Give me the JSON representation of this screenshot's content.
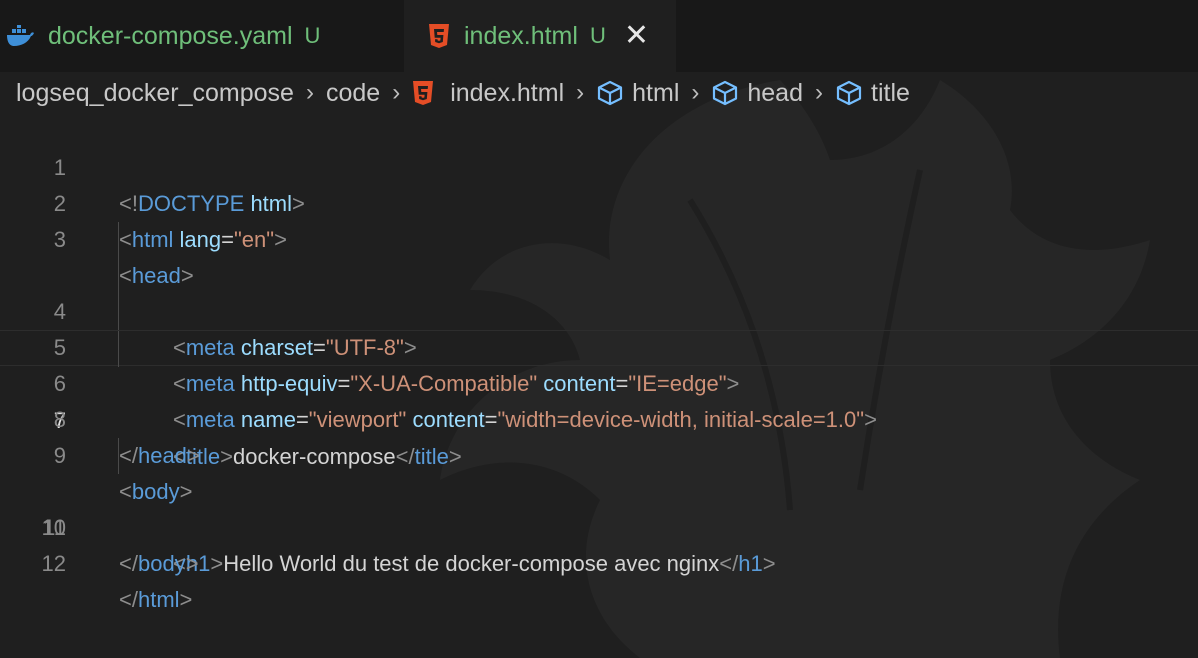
{
  "tabs": [
    {
      "label": "docker-compose.yaml",
      "badge": "U",
      "icon": "docker-whale-icon"
    },
    {
      "label": "index.html",
      "badge": "U",
      "icon": "html5-icon",
      "close": "✕"
    }
  ],
  "breadcrumb": {
    "items": [
      "logseq_docker_compose",
      "code",
      "index.html",
      "html",
      "head",
      "title"
    ],
    "separator": "›"
  },
  "editor": {
    "current_line": 7,
    "line_numbers": [
      "1",
      "2",
      "3",
      "4",
      "5",
      "6",
      "7",
      "8",
      "9",
      "10",
      "11",
      "12"
    ],
    "lines": {
      "l1": {
        "a": "<!",
        "b": "DOCTYPE",
        "c": " html",
        "d": ">"
      },
      "l2": {
        "a": "<",
        "b": "html",
        "c": " lang",
        "d": "=",
        "e": "\"en\"",
        "f": ">"
      },
      "l3": {
        "a": "<",
        "b": "head",
        "c": ">"
      },
      "l4": {
        "a": "<",
        "b": "meta",
        "c": " charset",
        "d": "=",
        "e": "\"UTF-8\"",
        "f": ">"
      },
      "l5": {
        "a": "<",
        "b": "meta",
        "c": " http-equiv",
        "d": "=",
        "e": "\"X-UA-Compatible\"",
        "f": " content",
        "g": "=",
        "h": "\"IE=edge\"",
        "i": ">"
      },
      "l6": {
        "a": "<",
        "b": "meta",
        "c": " name",
        "d": "=",
        "e": "\"viewport\"",
        "f": " content",
        "g": "=",
        "h": "\"width=device-width, initial-scale=1.0\"",
        "i": ">"
      },
      "l7": {
        "a": "<",
        "b": "title",
        "c": ">",
        "d": "docker-compose",
        "e": "</",
        "f": "title",
        "g": ">"
      },
      "l8": {
        "a": "</",
        "b": "head",
        "c": ">"
      },
      "l9": {
        "a": "<",
        "b": "body",
        "c": ">"
      },
      "l10": {
        "a": "<",
        "b": "h1",
        "c": ">",
        "d": "Hello World du test de docker-compose avec nginx",
        "e": "</",
        "f": "h1",
        "g": ">"
      },
      "l11": {
        "a": "</",
        "b": "body",
        "c": ">"
      },
      "l12": {
        "a": "</",
        "b": "html",
        "c": ">"
      }
    }
  },
  "colors": {
    "background": "#1f1f1f",
    "tab_modified": "#6fbf7a",
    "tag": "#5a9bd8",
    "attribute": "#9cdcfe",
    "string": "#ce9178",
    "html5_orange": "#e44d26",
    "symbol_blue": "#75beff"
  }
}
